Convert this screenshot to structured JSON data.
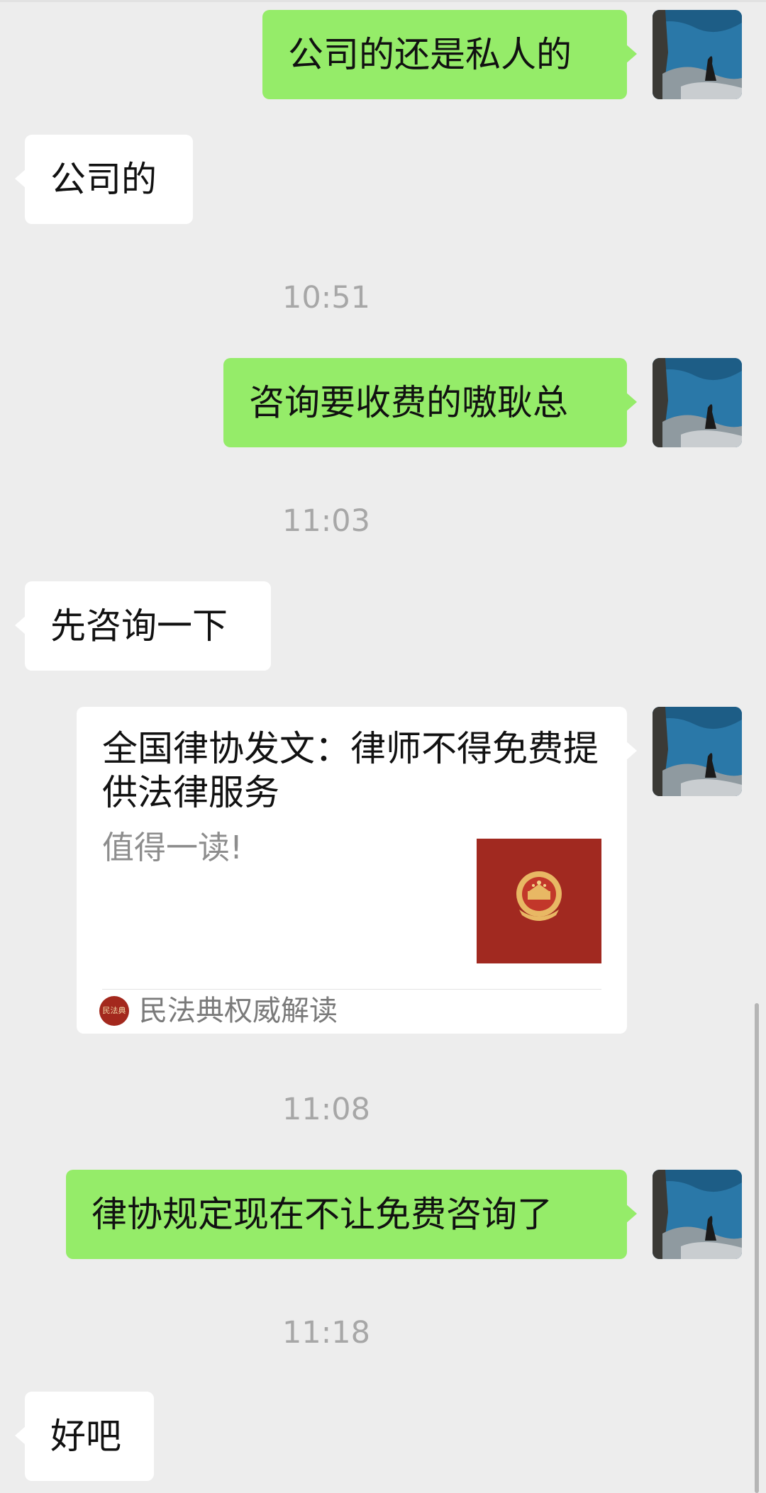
{
  "messages": [
    {
      "side": "sent",
      "text": "公司的还是私人的"
    },
    {
      "side": "recv",
      "text": "公司的"
    },
    {
      "type": "time",
      "text": "10:51"
    },
    {
      "side": "sent",
      "text": "咨询要收费的嗷耿总"
    },
    {
      "type": "time",
      "text": "11:03"
    },
    {
      "side": "recv",
      "text": "先咨询一下"
    },
    {
      "type": "article",
      "side": "sent",
      "title": "全国律协发文：律师不得免费提供法律服务",
      "description": "值得一读!",
      "source_icon_text": "民法典",
      "source": "民法典权威解读"
    },
    {
      "type": "time",
      "text": "11:08"
    },
    {
      "side": "sent",
      "text": "律协规定现在不让免费咨询了"
    },
    {
      "type": "time",
      "text": "11:18"
    },
    {
      "side": "recv",
      "text": "好吧"
    }
  ],
  "colors": {
    "background": "#ededed",
    "sent_bubble": "#95ec69",
    "recv_bubble": "#ffffff",
    "timestamp": "#a7a7a7",
    "article_thumb": "#a12920"
  },
  "icons": {
    "avatar": "seaside-photo-avatar",
    "article_thumb": "national-emblem-icon"
  }
}
